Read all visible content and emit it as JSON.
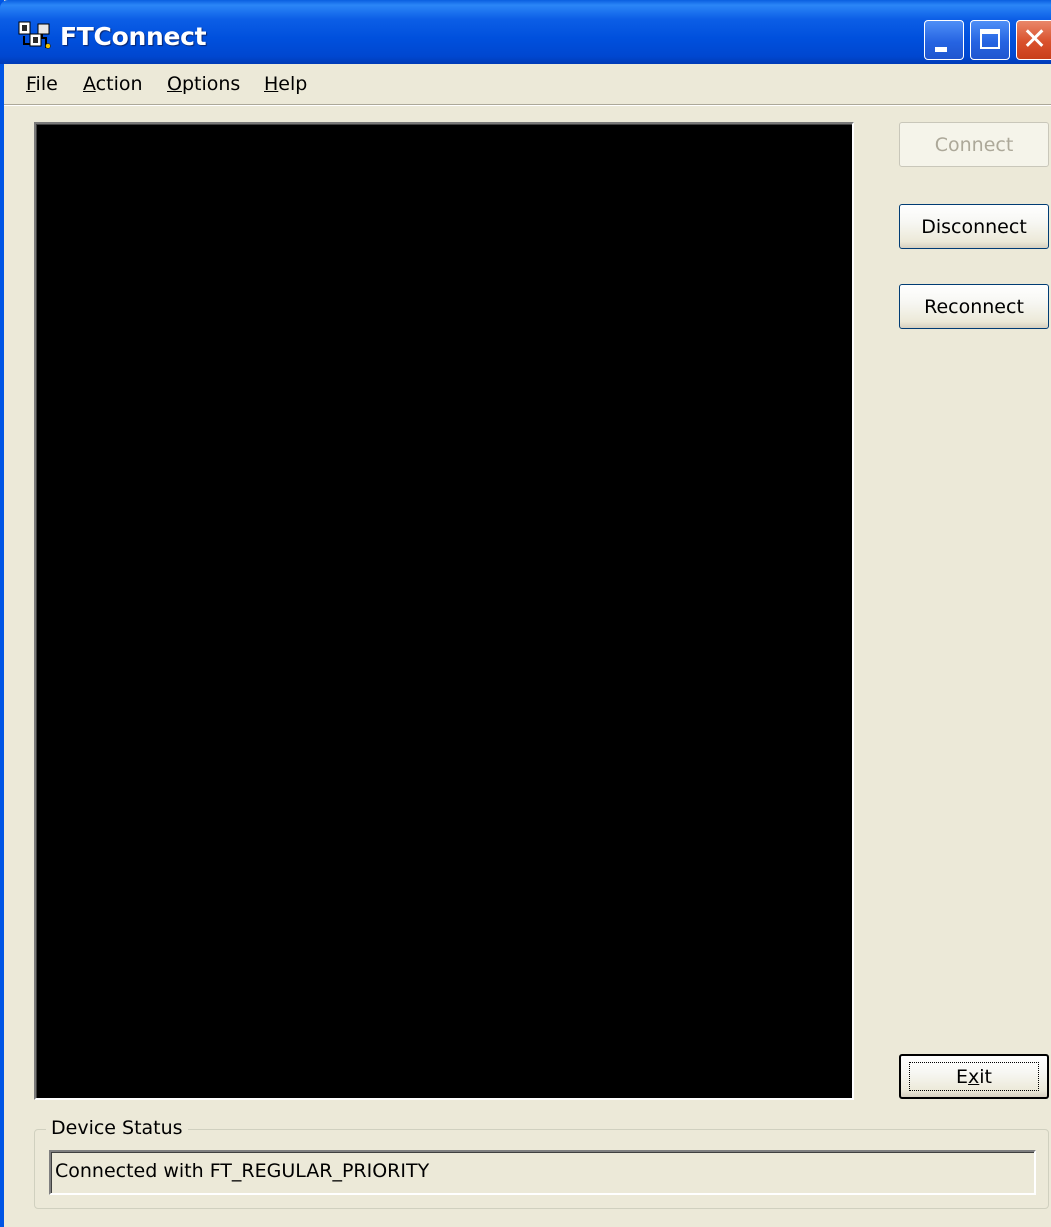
{
  "window": {
    "title": "FTConnect",
    "icon": "ftconnect-app-icon",
    "controls": {
      "minimize_icon": "minimize-icon",
      "maximize_icon": "maximize-icon",
      "close_icon": "close-icon"
    }
  },
  "menu": {
    "file": {
      "label": "File",
      "accel": "F",
      "rest": "ile"
    },
    "action": {
      "label": "Action",
      "accel": "A",
      "rest": "ction"
    },
    "options": {
      "label": "Options",
      "accel": "O",
      "rest": "ptions"
    },
    "help": {
      "label": "Help",
      "accel": "H",
      "rest": "elp"
    }
  },
  "buttons": {
    "connect": {
      "label": "Connect",
      "enabled": false
    },
    "disconnect": {
      "label": "Disconnect",
      "enabled": true
    },
    "reconnect": {
      "label": "Reconnect",
      "enabled": true
    },
    "exit": {
      "label": "Exit",
      "pre": "E",
      "accel": "x",
      "post": "it",
      "enabled": true
    }
  },
  "device_status": {
    "group_label": "Device Status",
    "value": "Connected with FT_REGULAR_PRIORITY"
  },
  "colors": {
    "titlebar": "#0054e3",
    "face": "#ece9d8",
    "display_bg": "#000000",
    "close_button": "#d9512d"
  }
}
